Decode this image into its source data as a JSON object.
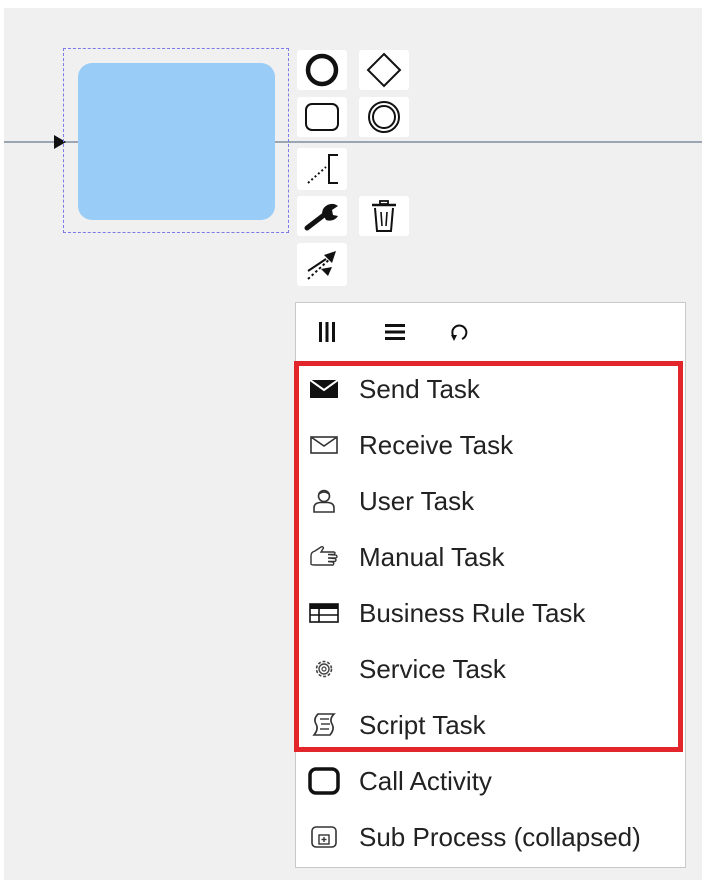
{
  "colors": {
    "task_fill": "#99ccf7",
    "selection": "#7a7ae8",
    "highlight": "#e3262c",
    "canvas": "#f0f0f0",
    "flow": "#9aa7b3"
  },
  "context_pad": [
    {
      "name": "append-end-event",
      "icon": "thick-circle-icon"
    },
    {
      "name": "append-gateway",
      "icon": "diamond-icon"
    },
    {
      "name": "append-task",
      "icon": "rounded-rect-icon"
    },
    {
      "name": "append-intermediate-event",
      "icon": "double-circle-icon"
    },
    {
      "name": "append-text-annotation",
      "icon": "annotation-icon"
    },
    {
      "name": "change-type",
      "icon": "wrench-icon"
    },
    {
      "name": "delete",
      "icon": "trash-icon"
    },
    {
      "name": "connect",
      "icon": "connect-arrow-icon"
    }
  ],
  "menu": {
    "header": [
      {
        "name": "parallel-multi-instance",
        "icon": "vertical-bars-icon"
      },
      {
        "name": "sequential-multi-instance",
        "icon": "horizontal-bars-icon"
      },
      {
        "name": "loop",
        "icon": "loop-icon"
      }
    ],
    "items": [
      {
        "label": "Send Task",
        "icon": "envelope-filled-icon"
      },
      {
        "label": "Receive Task",
        "icon": "envelope-outline-icon"
      },
      {
        "label": "User Task",
        "icon": "user-icon"
      },
      {
        "label": "Manual Task",
        "icon": "hand-icon"
      },
      {
        "label": "Business Rule Task",
        "icon": "table-icon"
      },
      {
        "label": "Service Task",
        "icon": "gear-icon"
      },
      {
        "label": "Script Task",
        "icon": "script-icon"
      },
      {
        "label": "Call Activity",
        "icon": "thick-rounded-rect-icon"
      },
      {
        "label": "Sub Process (collapsed)",
        "icon": "subprocess-collapsed-icon"
      }
    ]
  }
}
